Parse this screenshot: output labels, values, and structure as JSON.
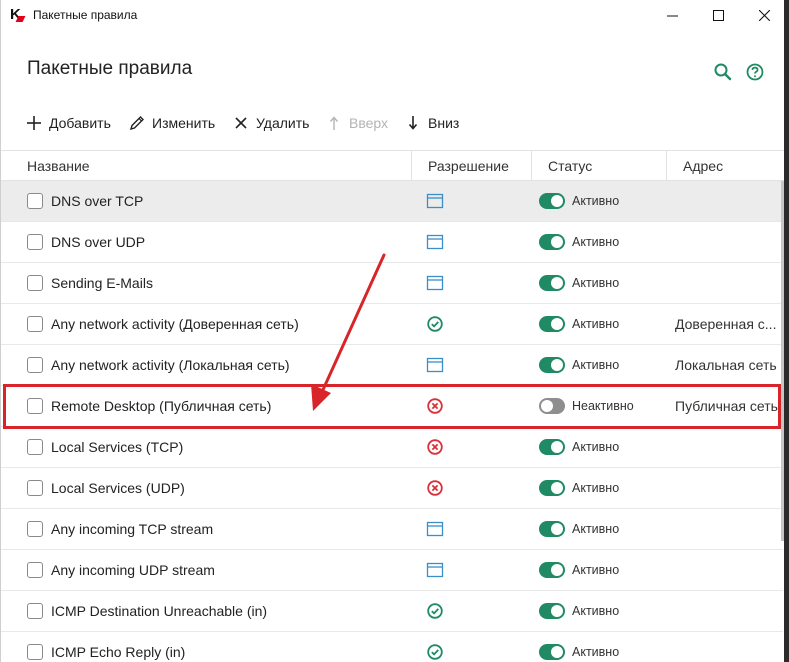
{
  "window": {
    "title": "Пакетные правила"
  },
  "header": {
    "title": "Пакетные правила"
  },
  "toolbar": {
    "add": "Добавить",
    "edit": "Изменить",
    "delete": "Удалить",
    "up": "Вверх",
    "down": "Вниз"
  },
  "table": {
    "columns": [
      "Название",
      "Разрешение",
      "Статус",
      "Адрес"
    ],
    "rows": [
      {
        "name": "DNS over TCP",
        "permission": "window-icon",
        "status": "Активно",
        "enabled": true,
        "address": ""
      },
      {
        "name": "DNS over UDP",
        "permission": "window-icon",
        "status": "Активно",
        "enabled": true,
        "address": ""
      },
      {
        "name": "Sending E-Mails",
        "permission": "window-icon",
        "status": "Активно",
        "enabled": true,
        "address": ""
      },
      {
        "name": "Any network activity (Доверенная сеть)",
        "permission": "allow-check-icon",
        "status": "Активно",
        "enabled": true,
        "address": "Доверенная с..."
      },
      {
        "name": "Any network activity (Локальная сеть)",
        "permission": "window-icon",
        "status": "Активно",
        "enabled": true,
        "address": "Локальная сеть"
      },
      {
        "name": "Remote Desktop (Публичная сеть)",
        "permission": "block-x-icon",
        "status": "Неактивно",
        "enabled": false,
        "address": "Публичная сеть"
      },
      {
        "name": "Local Services (TCP)",
        "permission": "block-x-icon",
        "status": "Активно",
        "enabled": true,
        "address": ""
      },
      {
        "name": "Local Services (UDP)",
        "permission": "block-x-icon",
        "status": "Активно",
        "enabled": true,
        "address": ""
      },
      {
        "name": "Any incoming TCP stream",
        "permission": "window-icon",
        "status": "Активно",
        "enabled": true,
        "address": ""
      },
      {
        "name": "Any incoming UDP stream",
        "permission": "window-icon",
        "status": "Активно",
        "enabled": true,
        "address": ""
      },
      {
        "name": "ICMP Destination Unreachable (in)",
        "permission": "allow-check-icon",
        "status": "Активно",
        "enabled": true,
        "address": ""
      },
      {
        "name": "ICMP Echo Reply (in)",
        "permission": "allow-check-icon",
        "status": "Активно",
        "enabled": true,
        "address": ""
      }
    ]
  },
  "colors": {
    "accent_green": "#1f8a63",
    "block_red": "#d9303a",
    "window_blue": "#3b8fc9",
    "annotation_red": "#d8252a"
  }
}
